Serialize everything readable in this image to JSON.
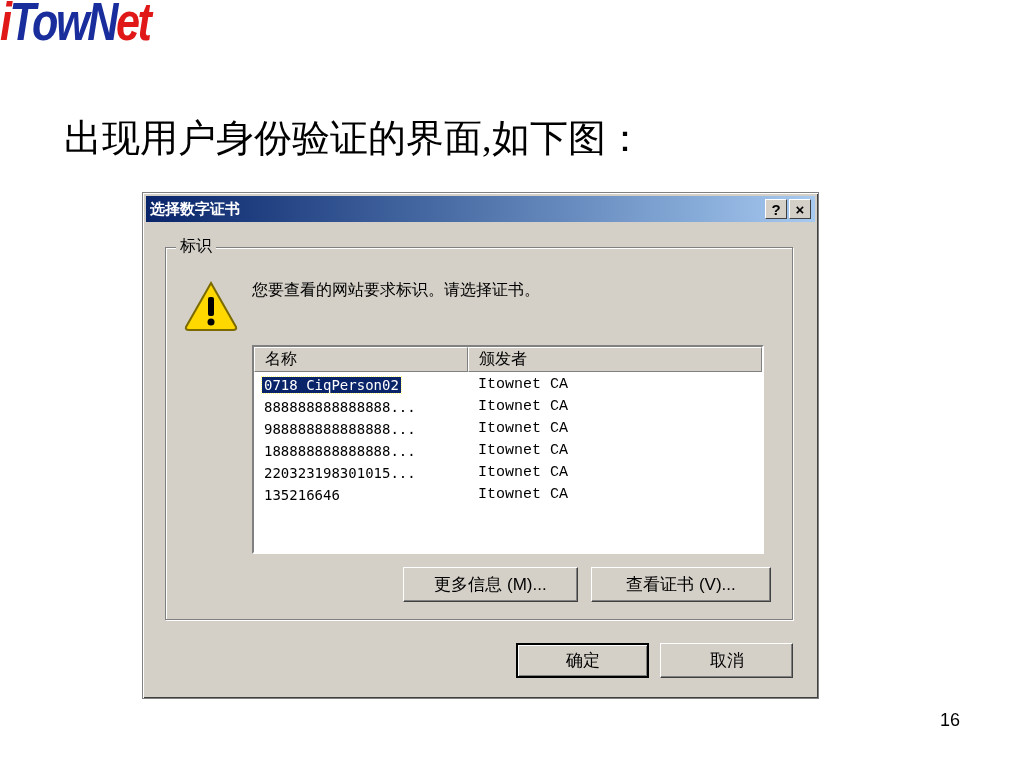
{
  "logo": [
    {
      "text": "i",
      "color": "#e01818"
    },
    {
      "text": "TowN",
      "color": "#1a2d9c"
    },
    {
      "text": "et",
      "color": "#e01818"
    }
  ],
  "heading": "出现用户身份验证的界面,如下图：",
  "dialog": {
    "title": "选择数字证书",
    "title_buttons": [
      "?",
      "×"
    ],
    "group": {
      "label": "标识",
      "message": "您要查看的网站要求标识。请选择证书。",
      "list": {
        "columns": [
          "名称",
          "颁发者"
        ],
        "rows": [
          {
            "name": "0718 CiqPerson02",
            "issuer": "Itownet CA",
            "selected": true
          },
          {
            "name": "888888888888888...",
            "issuer": "Itownet CA",
            "selected": false
          },
          {
            "name": "988888888888888...",
            "issuer": "Itownet CA",
            "selected": false
          },
          {
            "name": "188888888888888...",
            "issuer": "Itownet CA",
            "selected": false
          },
          {
            "name": "220323198301015...",
            "issuer": "Itownet CA",
            "selected": false
          },
          {
            "name": "135216646",
            "issuer": "Itownet CA",
            "selected": false
          }
        ]
      },
      "buttons": [
        "更多信息 (M)...",
        "查看证书 (V)..."
      ]
    },
    "buttons": [
      {
        "label": "确定",
        "default": true
      },
      {
        "label": "取消",
        "default": false
      }
    ]
  },
  "page_number": "16"
}
